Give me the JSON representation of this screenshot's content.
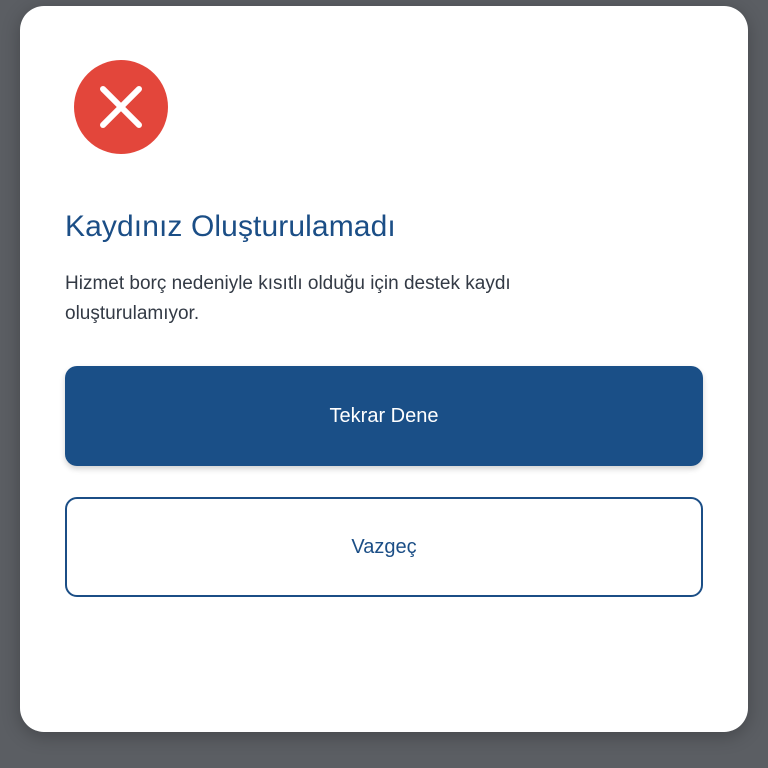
{
  "dialog": {
    "icon": "close-x-icon",
    "title": "Kaydınız Oluşturulamadı",
    "message": "Hizmet borç nedeniyle kısıtlı olduğu için destek kaydı oluşturulamıyor.",
    "primary_button_label": "Tekrar Dene",
    "secondary_button_label": "Vazgeç"
  },
  "colors": {
    "error": "#e3463b",
    "primary": "#1a4f87",
    "backdrop": "#5b5e63"
  }
}
